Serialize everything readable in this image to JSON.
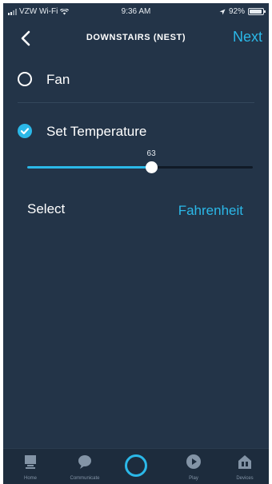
{
  "status_bar": {
    "carrier": "VZW Wi-Fi",
    "time": "9:36 AM",
    "battery_percent": "92%",
    "battery_level": 0.92
  },
  "header": {
    "back_icon": "chevron-left-icon",
    "title": "DOWNSTAIRS (NEST)",
    "next_label": "Next"
  },
  "options": [
    {
      "label": "Fan",
      "selected": false
    },
    {
      "label": "Set Temperature",
      "selected": true
    }
  ],
  "slider": {
    "value": "63",
    "min": 50,
    "max": 90,
    "position_fraction": 0.55
  },
  "units": {
    "label": "Select",
    "value": "Fahrenheit"
  },
  "tab_bar": {
    "items": [
      {
        "label": "Home",
        "icon": "home-icon"
      },
      {
        "label": "Communicate",
        "icon": "chat-bubble-icon"
      },
      {
        "label": "",
        "icon": "alexa-ring-icon"
      },
      {
        "label": "Play",
        "icon": "play-icon"
      },
      {
        "label": "Devices",
        "icon": "devices-icon"
      }
    ]
  },
  "colors": {
    "background": "#233448",
    "accent": "#2bb8e8",
    "text": "#ffffff"
  }
}
